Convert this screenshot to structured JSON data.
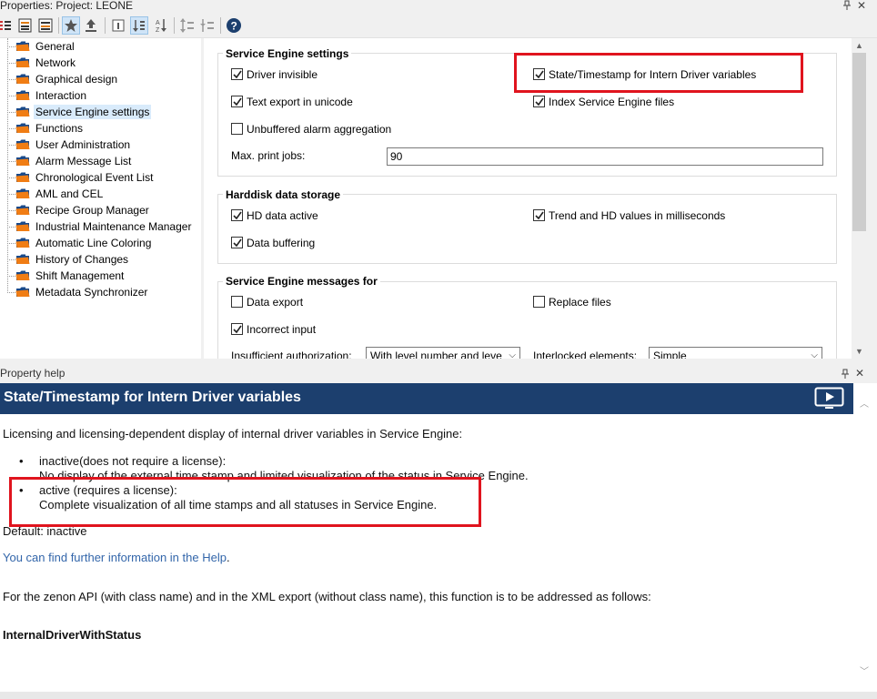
{
  "window": {
    "title": "Properties: Project: LEONE",
    "pin_icon": "pin-icon",
    "close_icon": "close-icon"
  },
  "toolbar": {
    "buttons": [
      {
        "name": "list-view-icon"
      },
      {
        "name": "list-alpha-icon"
      },
      {
        "name": "list-group-icon"
      },
      {
        "name": "favorites-star-icon"
      },
      {
        "name": "export-up-icon"
      },
      {
        "name": "info-box-icon"
      },
      {
        "name": "sort-order-icon"
      },
      {
        "name": "sort-alpha-icon"
      },
      {
        "name": "expand-all-icon"
      },
      {
        "name": "collapse-all-icon"
      },
      {
        "name": "help-icon"
      }
    ]
  },
  "tree": {
    "items": [
      {
        "label": "General",
        "selected": false
      },
      {
        "label": "Network",
        "selected": false
      },
      {
        "label": "Graphical design",
        "selected": false
      },
      {
        "label": "Interaction",
        "selected": false
      },
      {
        "label": "Service Engine settings",
        "selected": true
      },
      {
        "label": "Functions",
        "selected": false
      },
      {
        "label": "User Administration",
        "selected": false
      },
      {
        "label": "Alarm Message List",
        "selected": false
      },
      {
        "label": "Chronological Event List",
        "selected": false
      },
      {
        "label": "AML and CEL",
        "selected": false
      },
      {
        "label": "Recipe Group Manager",
        "selected": false
      },
      {
        "label": "Industrial Maintenance Manager",
        "selected": false
      },
      {
        "label": "Automatic Line Coloring",
        "selected": false
      },
      {
        "label": "History of Changes",
        "selected": false
      },
      {
        "label": "Shift Management",
        "selected": false
      },
      {
        "label": "Metadata Synchronizer",
        "selected": false
      }
    ]
  },
  "groups": {
    "service_engine": {
      "title": "Service Engine settings",
      "driver_invisible": {
        "label": "Driver invisible",
        "checked": true
      },
      "state_timestamp": {
        "label": "State/Timestamp for Intern Driver variables",
        "checked": true
      },
      "text_export_unicode": {
        "label": "Text export in unicode",
        "checked": true
      },
      "index_files": {
        "label": "Index Service Engine files",
        "checked": true
      },
      "unbuffered_alarm": {
        "label": "Unbuffered alarm aggregation",
        "checked": false
      },
      "max_print_jobs_label": "Max. print jobs:",
      "max_print_jobs_value": "90"
    },
    "harddisk": {
      "title": "Harddisk data storage",
      "hd_active": {
        "label": "HD data active",
        "checked": true
      },
      "trend_ms": {
        "label": "Trend and HD values in milliseconds",
        "checked": true
      },
      "data_buffering": {
        "label": "Data buffering",
        "checked": true
      }
    },
    "messages": {
      "title": "Service Engine messages for",
      "data_export": {
        "label": "Data export",
        "checked": false
      },
      "replace_files": {
        "label": "Replace files",
        "checked": false
      },
      "incorrect_input": {
        "label": "Incorrect input",
        "checked": true
      },
      "insufficient_auth_label": "Insufficient authorization:",
      "insufficient_auth_value": "With level number and leve",
      "interlocked_label": "Interlocked elements:",
      "interlocked_value": "Simple"
    }
  },
  "help": {
    "panel_title": "Property help",
    "header_title": "State/Timestamp for Intern Driver variables",
    "intro": "Licensing and licensing-dependent display of internal driver variables in Service Engine:",
    "bullets": [
      {
        "title": "inactive(does not require a license):",
        "text": "No display of the external time stamp and limited visualization of the status in Service Engine."
      },
      {
        "title": "active (requires a license):",
        "text": "Complete visualization of all time stamps and all statuses in Service Engine."
      }
    ],
    "default": "Default: inactive",
    "link": "You can find further information in the Help",
    "link_suffix": ".",
    "api_note": "For the zenon API (with class name) and in the XML export (without class name), this function is to be addressed as follows:",
    "api_name": "InternalDriverWithStatus"
  }
}
